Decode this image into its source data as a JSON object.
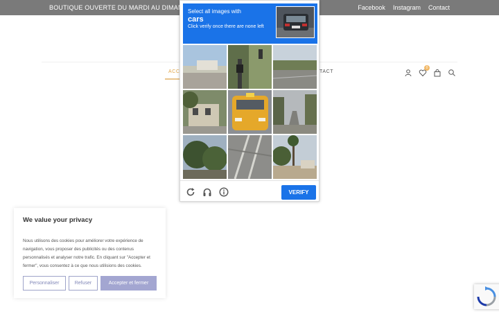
{
  "topbar": {
    "announcement": "BOUTIQUE OUVERTE DU MARDI AU DIMANCHE HA",
    "links": [
      "Facebook",
      "Instagram",
      "Contact"
    ]
  },
  "nav": {
    "left_fragment": "ACC",
    "right_fragment": "TACT",
    "cart_count": "0"
  },
  "captcha": {
    "instruction": "Select all images with",
    "target": "cars",
    "hint": "Click verify once there are none left",
    "verify_label": "VERIFY",
    "icons": [
      "reload-icon",
      "audio-icon",
      "info-icon"
    ]
  },
  "cookie": {
    "title": "We value your privacy",
    "body": "Nous utilisons des cookies pour améliorer votre expérience de navigation, vous proposer des publicités ou des contenus personnalisés et analyser notre trafic. En cliquant sur \"Accepter et fermer\", vous consentez à ce que nous utilisions des cookies.",
    "customize_label": "Personnaliser",
    "refuse_label": "Refuser",
    "accept_label": "Accepter et fermer"
  },
  "colors": {
    "topbar_bg": "#7a7a7a",
    "captcha_blue": "#1a73e8",
    "accent_gold": "#e0a64a",
    "cookie_purple": "#a3a6d1"
  }
}
